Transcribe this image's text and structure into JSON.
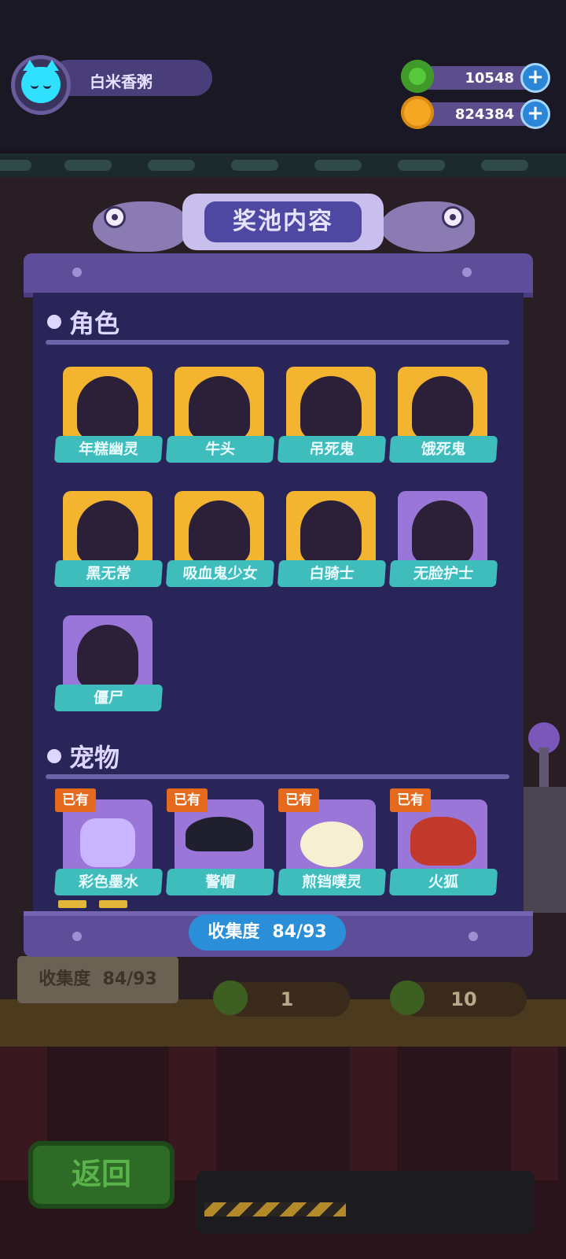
{
  "player": {
    "name": "白米香粥",
    "avatar_icon": "cyan-cat-icon"
  },
  "currencies": [
    {
      "icon": "green-donut-icon",
      "value": "10548",
      "color": "#57c93a"
    },
    {
      "icon": "orange-planet-icon",
      "value": "824384",
      "color": "#f5a623"
    }
  ],
  "panel": {
    "title": "奖池内容",
    "sections": {
      "characters": {
        "label": "角色",
        "items": [
          {
            "name": "年糕幽灵",
            "rarity": "gold"
          },
          {
            "name": "牛头",
            "rarity": "gold"
          },
          {
            "name": "吊死鬼",
            "rarity": "gold"
          },
          {
            "name": "饿死鬼",
            "rarity": "gold"
          },
          {
            "name": "黑无常",
            "rarity": "gold"
          },
          {
            "name": "吸血鬼少女",
            "rarity": "gold"
          },
          {
            "name": "白骑士",
            "rarity": "gold"
          },
          {
            "name": "无脸护士",
            "rarity": "purple"
          },
          {
            "name": "僵尸",
            "rarity": "purple"
          }
        ]
      },
      "pets": {
        "label": "宠物",
        "owned_label": "已有",
        "items": [
          {
            "name": "彩色墨水",
            "owned": true
          },
          {
            "name": "警帽",
            "owned": true
          },
          {
            "name": "煎铛噗灵",
            "owned": true
          },
          {
            "name": "火狐",
            "owned": true
          }
        ]
      }
    },
    "collection": {
      "label": "收集度",
      "value": "84/93"
    }
  },
  "background": {
    "collection_label": "收集度",
    "collection_value": "84/93",
    "price_single": "1",
    "price_multi": "10"
  },
  "back_button": "返回"
}
